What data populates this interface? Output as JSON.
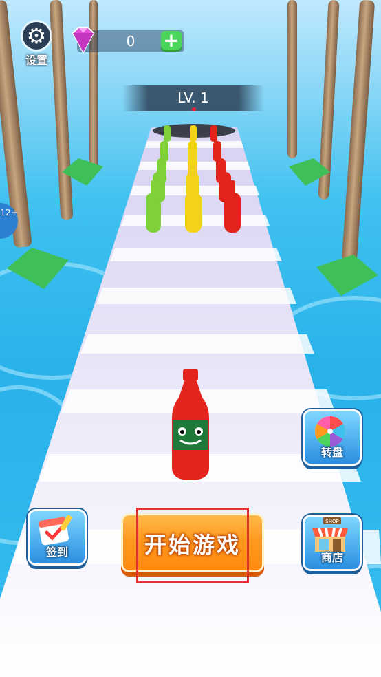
{
  "hud": {
    "settings_label": "设置",
    "gem_count": "0",
    "plus_label": "+",
    "level_label": "LV. 1"
  },
  "buttons": {
    "wheel_label": "转盘",
    "checkin_label": "签到",
    "shop_label": "商店",
    "start_label": "开始游戏"
  },
  "shop_sign": "SHOP",
  "age_badge": "12+",
  "colors": {
    "water": "#29b2ea",
    "track_stripe_a": "#ffffff",
    "track_stripe_b": "#dcd6f5",
    "start_button": "#ff9a1f",
    "card_button": "#2a8fe0",
    "plus_button": "#4bd65b",
    "bottle_red": "#e3241c",
    "bottle_green": "#7fd03a",
    "bottle_yellow": "#f2d21a",
    "highlight": "#e0322f"
  },
  "icons": {
    "settings": "gear-icon",
    "gem": "diamond-icon",
    "wheel": "prize-wheel-icon",
    "checkin": "calendar-check-icon",
    "shop": "storefront-icon"
  }
}
